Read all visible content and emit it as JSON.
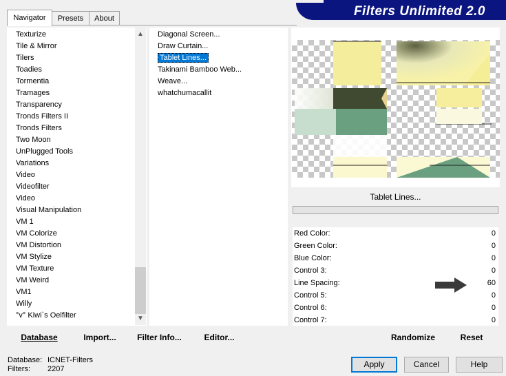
{
  "tabs": [
    "Navigator",
    "Presets",
    "About"
  ],
  "app_title": "Filters Unlimited 2.0",
  "categories": [
    "Texturize",
    "Tile & Mirror",
    "Tilers",
    "Toadies",
    "Tormentia",
    "Tramages",
    "Transparency",
    "Tronds Filters II",
    "Tronds Filters",
    "Two Moon",
    "UnPlugged Tools",
    "Variations",
    "Video",
    "Videofilter",
    "Video",
    "Visual Manipulation",
    "VM 1",
    "VM Colorize",
    "VM Distortion",
    "VM Stylize",
    "VM Texture",
    "VM Weird",
    "VM1",
    "Willy",
    "°v° Kiwi`s Oelfilter"
  ],
  "filters": [
    "Diagonal Screen...",
    "Draw Curtain...",
    "Tablet Lines...",
    "Takinami Bamboo Web...",
    "Weave...",
    "whatchumacallit"
  ],
  "selected_filter_index": 2,
  "buttons": {
    "database": "Database",
    "import": "Import...",
    "filter_info": "Filter Info...",
    "editor": "Editor...",
    "randomize": "Randomize",
    "reset": "Reset",
    "apply": "Apply",
    "cancel": "Cancel",
    "help": "Help"
  },
  "current_filter": "Tablet Lines...",
  "controls": [
    {
      "label": "Red Color:",
      "value": "0"
    },
    {
      "label": "Green Color:",
      "value": "0"
    },
    {
      "label": "Blue Color:",
      "value": "0"
    },
    {
      "label": "Control 3:",
      "value": "0"
    },
    {
      "label": "Line Spacing:",
      "value": "60"
    },
    {
      "label": "Control 5:",
      "value": "0"
    },
    {
      "label": "Control 6:",
      "value": "0"
    },
    {
      "label": "Control 7:",
      "value": "0"
    }
  ],
  "status": {
    "database_label": "Database:",
    "database_value": "ICNET-Filters",
    "filters_label": "Filters:",
    "filters_value": "2207"
  },
  "icons": {
    "scroll_up": "scroll-up-arrow-icon",
    "scroll_down": "scroll-down-arrow-icon",
    "pointer": "dark-arrow-pointer-icon"
  },
  "colors": {
    "banner": "#0b1580",
    "selection": "#0078d7"
  }
}
